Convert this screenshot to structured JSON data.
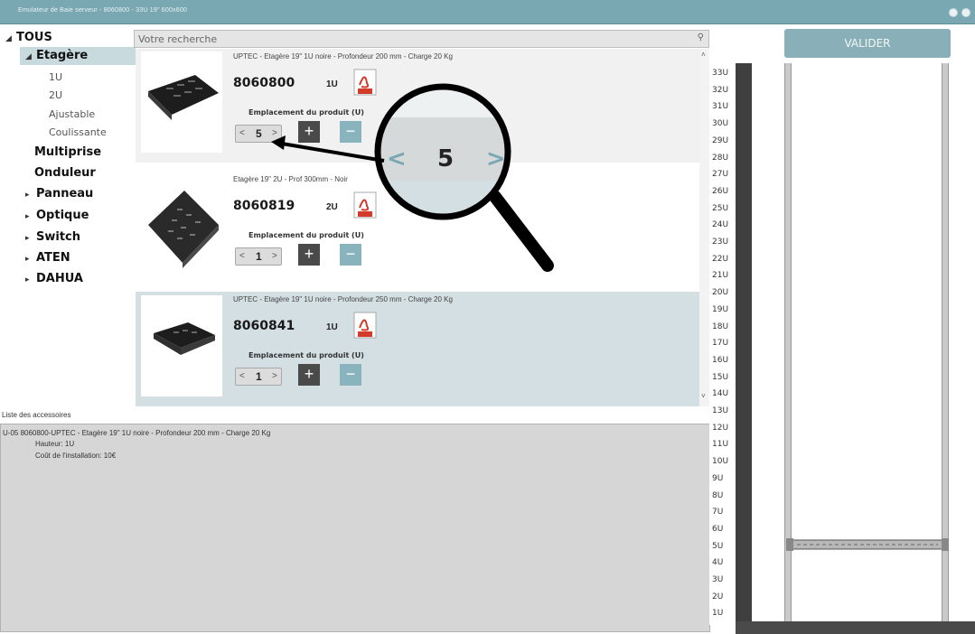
{
  "window": {
    "title": "Emulateur de Baie serveur - 8060800 - 33U 19\" 600x600"
  },
  "tree": {
    "items": [
      {
        "label": "TOUS",
        "arrow": "◢",
        "level": 0
      },
      {
        "label": "Etagère",
        "arrow": "◢",
        "level": 1,
        "selected": true
      },
      {
        "label": "1U",
        "level": 2
      },
      {
        "label": "2U",
        "level": 2
      },
      {
        "label": "Ajustable",
        "level": 2
      },
      {
        "label": "Coulissante",
        "level": 2
      },
      {
        "label": "Multiprise",
        "level": 1
      },
      {
        "label": "Onduleur",
        "level": 1
      },
      {
        "label": "Panneau",
        "arrow": "▸",
        "level": 0
      },
      {
        "label": "Optique",
        "arrow": "▸",
        "level": 0
      },
      {
        "label": "Switch",
        "arrow": "▸",
        "level": 0
      },
      {
        "label": "ATEN",
        "arrow": "▸",
        "level": 0
      },
      {
        "label": "DAHUA",
        "arrow": "▸",
        "level": 0
      }
    ]
  },
  "search": {
    "placeholder": "Votre recherche",
    "icon": "search-icon"
  },
  "products": [
    {
      "description": "UPTEC - Etagère 19\" 1U noire - Profondeur 200 mm - Charge 20 Kg",
      "reference": "8060800",
      "units": "1U",
      "position_label": "Emplacement du produit (U)",
      "position": "5",
      "prev": "<",
      "next": ">",
      "plus": "+",
      "minus": "−"
    },
    {
      "description": "Etagère 19\" 2U - Prof 300mm - Noir",
      "reference": "8060819",
      "units": "2U",
      "position_label": "Emplacement du produit (U)",
      "position": "1",
      "prev": "<",
      "next": ">",
      "plus": "+",
      "minus": "−"
    },
    {
      "description": "UPTEC - Etagère 19\" 1U noire - Profondeur 250 mm - Charge 20 Kg",
      "reference": "8060841",
      "units": "1U",
      "position_label": "Emplacement du produit (U)",
      "position": "1",
      "prev": "<",
      "next": ">",
      "plus": "+",
      "minus": "−"
    }
  ],
  "accessories": {
    "label": "Liste des accessoires",
    "lines": [
      "U-05  8060800-UPTEC - Etagère 19\" 1U noire - Profondeur 200 mm - Charge 20 Kg",
      "Hauteur: 1U",
      "Coût de l'installation: 10€"
    ]
  },
  "magnifier": {
    "value": "5",
    "prev": "<",
    "next": ">"
  },
  "rack": {
    "button_label": "VALIDER",
    "units": [
      "33U",
      "32U",
      "31U",
      "30U",
      "29U",
      "28U",
      "27U",
      "26U",
      "25U",
      "24U",
      "23U",
      "22U",
      "21U",
      "20U",
      "19U",
      "18U",
      "17U",
      "16U",
      "15U",
      "14U",
      "13U",
      "12U",
      "11U",
      "10U",
      "9U",
      "8U",
      "7U",
      "6U",
      "5U",
      "4U",
      "3U",
      "2U",
      "1U"
    ],
    "installed": {
      "reference": "8060800",
      "position_u": 5,
      "height_u": 1
    }
  },
  "colors": {
    "titlebar": "#7aa8b2",
    "accent": "#89b0b8",
    "selected": "#c9dadf",
    "pdf_red": "#d23b2a"
  }
}
